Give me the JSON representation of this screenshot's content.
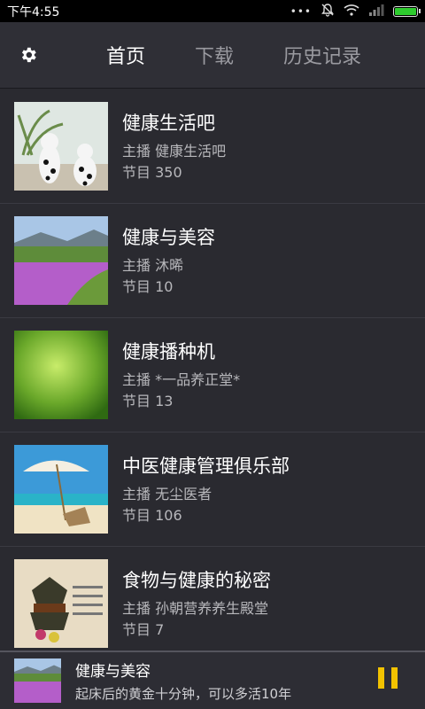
{
  "status_bar": {
    "time": "下午4:55",
    "icons": [
      "more-dots-icon",
      "notifications-off-icon",
      "wifi-icon",
      "signal-icon",
      "battery-icon"
    ],
    "battery_color": "#2ecc2e"
  },
  "header": {
    "settings_icon": "gear-icon",
    "tabs": [
      {
        "label": "首页",
        "active": true
      },
      {
        "label": "下载",
        "active": false
      },
      {
        "label": "历史记录",
        "active": false
      }
    ]
  },
  "channels": [
    {
      "title": "健康生活吧",
      "host_prefix": "主播",
      "host": "健康生活吧",
      "episodes_prefix": "节目",
      "episodes": "350"
    },
    {
      "title": "健康与美容",
      "host_prefix": "主播",
      "host": "沐晞",
      "episodes_prefix": "节目",
      "episodes": "10"
    },
    {
      "title": "健康播种机",
      "host_prefix": "主播",
      "host": "*一品养正堂*",
      "episodes_prefix": "节目",
      "episodes": "13"
    },
    {
      "title": "中医健康管理俱乐部",
      "host_prefix": "主播",
      "host": "无尘医者",
      "episodes_prefix": "节目",
      "episodes": "106"
    },
    {
      "title": "食物与健康的秘密",
      "host_prefix": "主播",
      "host": "孙朝营养养生殿堂",
      "episodes_prefix": "节目",
      "episodes": "7"
    }
  ],
  "player": {
    "title": "健康与美容",
    "subtitle": "起床后的黄金十分钟，可以多活10年",
    "pause_icon": "pause-icon",
    "accent": "#f2c200"
  }
}
